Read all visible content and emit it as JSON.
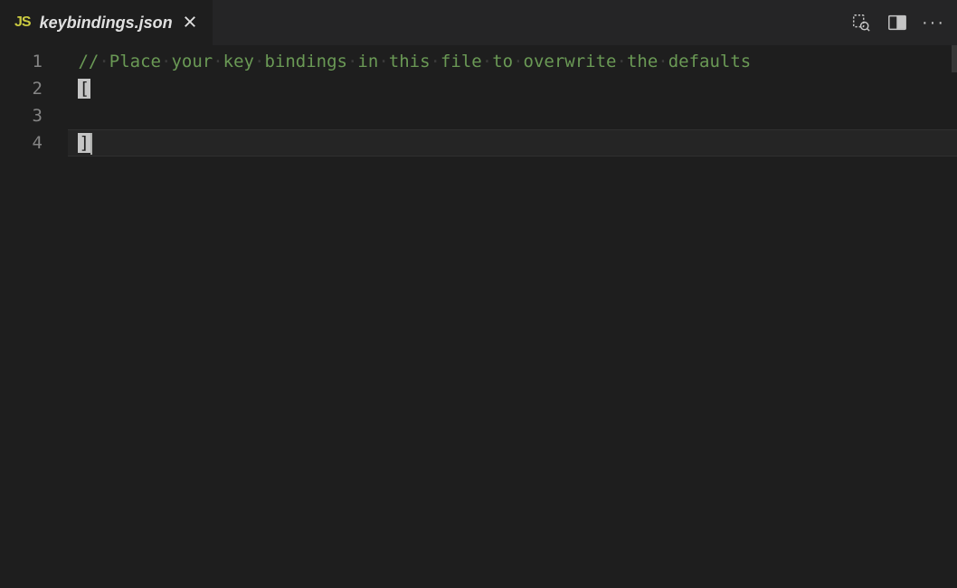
{
  "tab": {
    "icon_text": "JS",
    "filename": "keybindings.json"
  },
  "editor": {
    "line_numbers": [
      "1",
      "2",
      "3",
      "4"
    ],
    "lines": {
      "comment_tokens": [
        "//",
        "Place",
        "your",
        "key",
        "bindings",
        "in",
        "this",
        "file",
        "to",
        "overwrite",
        "the",
        "defaults"
      ],
      "open_bracket": "[",
      "close_bracket": "]"
    },
    "active_line": 4
  }
}
